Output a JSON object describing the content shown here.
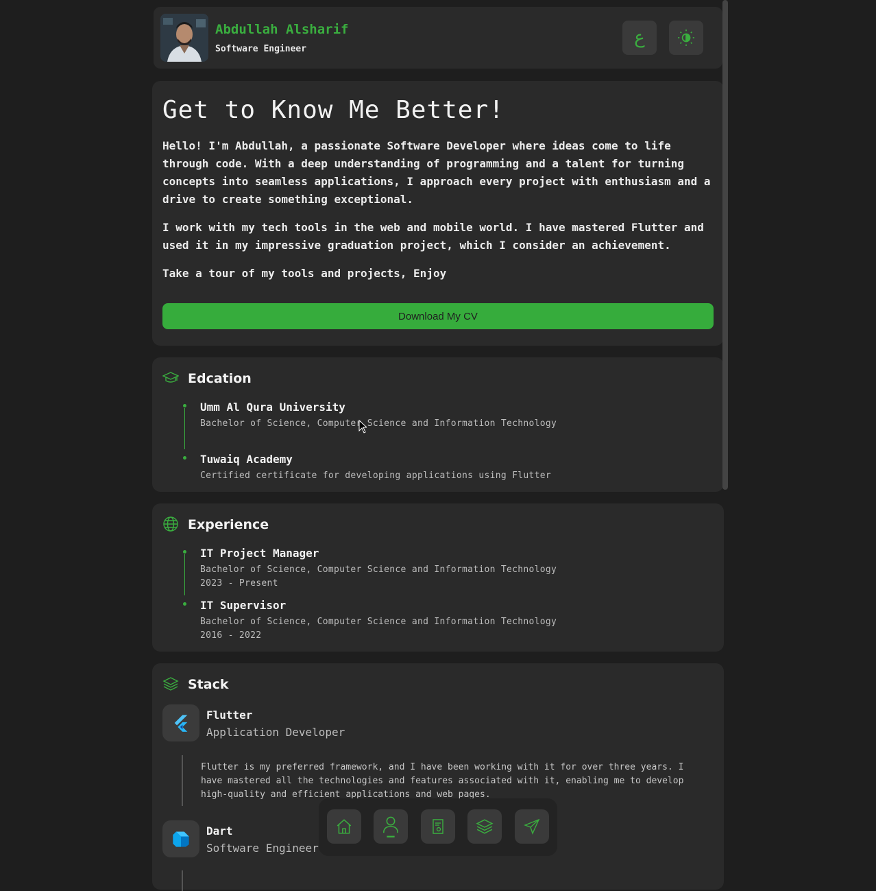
{
  "header": {
    "name": "Abdullah Alsharif",
    "role": "Software Engineer",
    "lang_button": "ع",
    "theme_icon": "sun-icon"
  },
  "about": {
    "title": "Get to Know Me Better!",
    "paragraphs": [
      "Hello! I'm Abdullah, a passionate Software Developer where ideas come to life through code. With a deep understanding of programming and a talent for turning concepts into seamless applications, I approach every project with enthusiasm and a drive to create something exceptional.",
      "I work with my tech tools in the web and mobile world. I have mastered Flutter and used it in my impressive graduation project, which I consider an achievement.",
      "Take a tour of my tools and projects, Enjoy"
    ],
    "cv_button": "Download My CV"
  },
  "education": {
    "title": "Edcation",
    "icon": "graduation-cap-icon",
    "items": [
      {
        "title": "Umm Al Qura University",
        "subtitle": "Bachelor of Science, Computer Science and Information Technology"
      },
      {
        "title": "Tuwaiq Academy",
        "subtitle": "Certified certificate for developing applications using Flutter"
      }
    ]
  },
  "experience": {
    "title": "Experience",
    "icon": "globe-icon",
    "items": [
      {
        "title": "IT Project Manager",
        "subtitle": "Bachelor of Science, Computer Science and Information Technology",
        "period": "2023 - Present"
      },
      {
        "title": "IT Supervisor",
        "subtitle": "Bachelor of Science, Computer Science and Information Technology",
        "period": "2016 - 2022"
      }
    ]
  },
  "stack": {
    "title": "Stack",
    "icon": "layers-icon",
    "items": [
      {
        "name": "Flutter",
        "role": "Application Developer",
        "icon": "flutter-logo-icon",
        "description": "Flutter is my preferred framework, and I have been working with it for over three years. I have mastered all the technologies and features associated with it, enabling me to develop high-quality and efficient applications and web pages."
      },
      {
        "name": "Dart",
        "role": "Software Engineer",
        "icon": "dart-logo-icon"
      }
    ]
  },
  "dock": {
    "items": [
      "home-icon",
      "user-icon",
      "certificate-icon",
      "layers-icon",
      "send-icon"
    ]
  },
  "colors": {
    "accent": "#3aae3f",
    "background": "#1e1e1e",
    "card": "#2a2a2a"
  }
}
